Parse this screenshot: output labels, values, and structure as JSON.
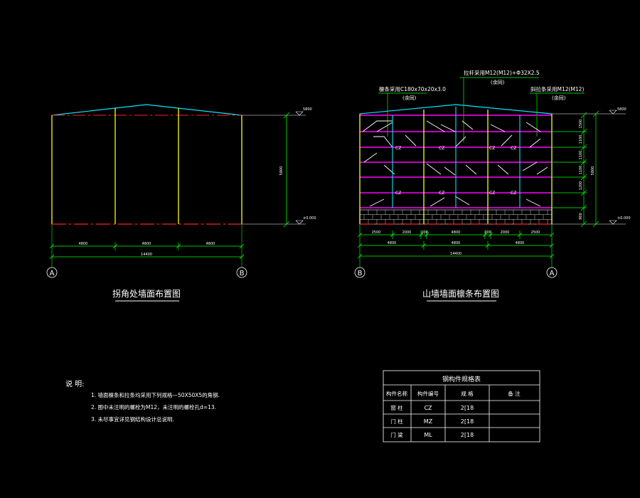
{
  "colors": {
    "background": "#000000",
    "column": "#ffff00",
    "roof": "#00e5ff",
    "dimension": "#00ff00",
    "purlin": "#ff00ff",
    "ground": "#ff2020",
    "brace": "#ffffff",
    "text": "#ffffff"
  },
  "left_view": {
    "title": "拐角处墙面布置图",
    "spans": [
      "4800",
      "4800",
      "4800"
    ],
    "total": "14400",
    "height": "5800",
    "elev_top": "5800",
    "elev_bottom": "±0.000",
    "axis_left": "A",
    "axis_right": "B"
  },
  "right_view": {
    "title": "山墙墙面檩条布置图",
    "callouts": [
      {
        "text": "檩条采用C180x70x20x3.0",
        "sub": "(余同)"
      },
      {
        "text": "拉杆采用M12(M12)+Φ32X2.5",
        "sub": "(余同)"
      },
      {
        "text": "斜拉条采用M12(M12)",
        "sub": "(余同)"
      }
    ],
    "top_dims": [
      "2500",
      "2000",
      "200",
      "4800",
      "200",
      "2000",
      "2500"
    ],
    "spans": [
      "4800",
      "4800",
      "4800"
    ],
    "total": "14400",
    "height": "5800",
    "vert_dims": [
      "1500",
      "1100",
      "1100",
      "1100",
      "1200",
      "900"
    ],
    "elev_top": "5800",
    "elev_bottom": "±0.000",
    "axis_left": "B",
    "axis_right": "A",
    "labels": [
      "CZ",
      "CZ",
      "CZ",
      "CZ",
      "CZ",
      "CZ",
      "CZ",
      "CZ"
    ]
  },
  "notes": {
    "title": "说 明:",
    "items": [
      "1. 墙面檩条和拉条均采用下列规格—50X50X5的角钢.",
      "2. 图中未注明的螺栓为M12，未注明的螺栓孔d=13.",
      "3. 未尽事宜详见钢结构设计总说明."
    ]
  },
  "table": {
    "title": "钢构件规格表",
    "headers": [
      "构件名称",
      "构件编号",
      "规 格",
      "备 注"
    ],
    "rows": [
      [
        "窗 柱",
        "CZ",
        "2[18",
        ""
      ],
      [
        "门 柱",
        "MZ",
        "2[18",
        ""
      ],
      [
        "门 梁",
        "ML",
        "2[18",
        ""
      ]
    ]
  }
}
